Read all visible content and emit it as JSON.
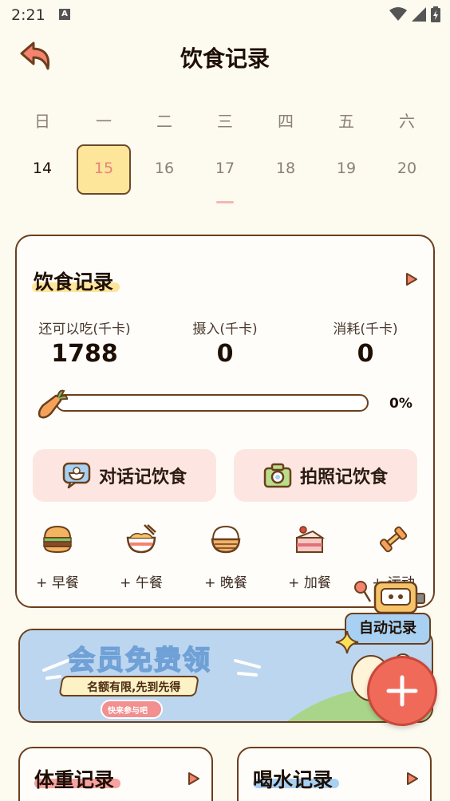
{
  "status_bar": {
    "time": "2:21",
    "notif_icon_letter": "A"
  },
  "header": {
    "title": "饮食记录"
  },
  "calendar": {
    "weekdays": [
      "日",
      "一",
      "二",
      "三",
      "四",
      "五",
      "六"
    ],
    "days": [
      "14",
      "15",
      "16",
      "17",
      "18",
      "19",
      "20"
    ],
    "selected_day": "15"
  },
  "diet_card": {
    "title": "饮食记录",
    "remaining_label": "还可以吃(千卡)",
    "remaining_value": "1788",
    "intake_label": "摄入(千卡)",
    "intake_value": "0",
    "burn_label": "消耗(千卡)",
    "burn_value": "0",
    "progress_percent": 0,
    "progress_text": "0%",
    "chat_button": "对话记饮食",
    "photo_button": "拍照记饮食",
    "meals": [
      {
        "label": "+ 早餐",
        "icon": "burger-icon"
      },
      {
        "label": "+ 午餐",
        "icon": "noodle-bowl-icon"
      },
      {
        "label": "+ 晚餐",
        "icon": "rice-bowl-icon"
      },
      {
        "label": "+ 加餐",
        "icon": "cake-icon"
      },
      {
        "label": "+ 运动",
        "icon": "dumbbell-icon"
      }
    ]
  },
  "auto_record": {
    "label": "自动记录"
  },
  "banner": {
    "headline": "会员免费领",
    "subline": "名额有限,先到先得",
    "cta": "快来参与吧"
  },
  "bottom_cards": [
    {
      "title": "体重记录"
    },
    {
      "title": "喝水记录"
    }
  ],
  "colors": {
    "accent_yellow": "#fde59a",
    "brown_border": "#6b3f1c",
    "fab_red": "#f06a5a",
    "action_pink": "#fde6e1"
  }
}
